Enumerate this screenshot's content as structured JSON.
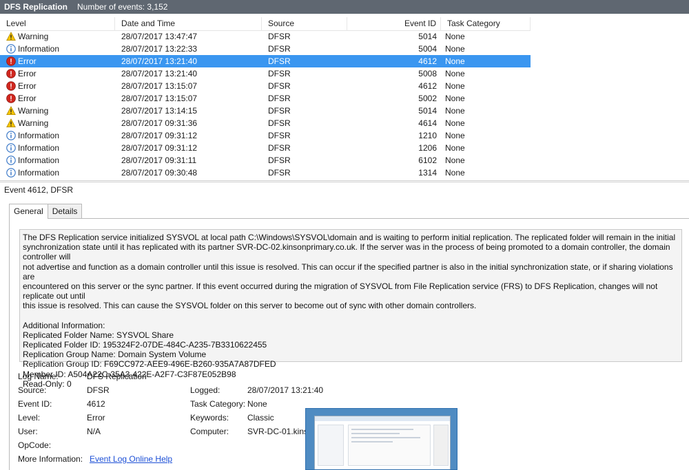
{
  "titlebar": {
    "app_name": "DFS Replication",
    "event_count": "Number of events: 3,152"
  },
  "columns": {
    "level": "Level",
    "date": "Date and Time",
    "source": "Source",
    "event_id": "Event ID",
    "task_category": "Task Category"
  },
  "events": [
    {
      "level": "Warning",
      "icon": "warning-icon",
      "date": "28/07/2017 13:47:47",
      "source": "DFSR",
      "event_id": "5014",
      "category": "None"
    },
    {
      "level": "Information",
      "icon": "information-icon",
      "date": "28/07/2017 13:22:33",
      "source": "DFSR",
      "event_id": "5004",
      "category": "None"
    },
    {
      "level": "Error",
      "icon": "error-icon",
      "date": "28/07/2017 13:21:40",
      "source": "DFSR",
      "event_id": "4612",
      "category": "None",
      "selected": true
    },
    {
      "level": "Error",
      "icon": "error-icon",
      "date": "28/07/2017 13:21:40",
      "source": "DFSR",
      "event_id": "5008",
      "category": "None"
    },
    {
      "level": "Error",
      "icon": "error-icon",
      "date": "28/07/2017 13:15:07",
      "source": "DFSR",
      "event_id": "4612",
      "category": "None"
    },
    {
      "level": "Error",
      "icon": "error-icon",
      "date": "28/07/2017 13:15:07",
      "source": "DFSR",
      "event_id": "5002",
      "category": "None"
    },
    {
      "level": "Warning",
      "icon": "warning-icon",
      "date": "28/07/2017 13:14:15",
      "source": "DFSR",
      "event_id": "5014",
      "category": "None"
    },
    {
      "level": "Warning",
      "icon": "warning-icon",
      "date": "28/07/2017 09:31:36",
      "source": "DFSR",
      "event_id": "4614",
      "category": "None"
    },
    {
      "level": "Information",
      "icon": "information-icon",
      "date": "28/07/2017 09:31:12",
      "source": "DFSR",
      "event_id": "1210",
      "category": "None"
    },
    {
      "level": "Information",
      "icon": "information-icon",
      "date": "28/07/2017 09:31:12",
      "source": "DFSR",
      "event_id": "1206",
      "category": "None"
    },
    {
      "level": "Information",
      "icon": "information-icon",
      "date": "28/07/2017 09:31:11",
      "source": "DFSR",
      "event_id": "6102",
      "category": "None"
    },
    {
      "level": "Information",
      "icon": "information-icon",
      "date": "28/07/2017 09:30:48",
      "source": "DFSR",
      "event_id": "1314",
      "category": "None"
    }
  ],
  "detail": {
    "header": "Event 4612, DFSR",
    "tabs": [
      "General",
      "Details"
    ],
    "description_lines": [
      "The DFS Replication service initialized SYSVOL at local path C:\\Windows\\SYSVOL\\domain and is waiting to perform initial replication. The replicated folder will remain in the initial",
      "synchronization state until it has replicated with its partner SVR-DC-02.kinsonprimary.co.uk. If the server was in the process of being promoted to a domain controller, the domain controller will",
      "not advertise and function as a domain controller until this issue is resolved. This can occur if the specified partner is also in the initial synchronization state, or if sharing violations are",
      "encountered on this server or the sync partner. If this event occurred during the migration of SYSVOL from File Replication service (FRS) to DFS Replication, changes will not replicate out until",
      "this issue is resolved. This can cause the SYSVOL folder on this server to become out of sync with other domain controllers."
    ],
    "additional_lines": [
      "Additional Information:",
      "Replicated Folder Name: SYSVOL Share",
      "Replicated Folder ID: 195324F2-07DE-484C-A235-7B3310622455",
      "Replication Group Name: Domain System Volume",
      "Replication Group ID: F69CC972-AEE9-496E-B260-935A7A87DFED",
      "Member ID: A504A22C-35A3-422E-A2F7-C3F87E052B98",
      "Read-Only: 0"
    ],
    "fields": {
      "log_name_label": "Log Name:",
      "log_name": "DFS Replication",
      "source_label": "Source:",
      "source": "DFSR",
      "logged_label": "Logged:",
      "logged": "28/07/2017 13:21:40",
      "event_id_label": "Event ID:",
      "event_id": "4612",
      "task_category_label": "Task Category:",
      "task_category": "None",
      "level_label": "Level:",
      "level": "Error",
      "keywords_label": "Keywords:",
      "keywords": "Classic",
      "user_label": "User:",
      "user": "N/A",
      "computer_label": "Computer:",
      "computer": "SVR-DC-01.kinso",
      "opcode_label": "OpCode:",
      "more_info_label": "More Information:",
      "more_info_link": "Event Log Online Help"
    }
  },
  "colors": {
    "titlebar": "#5f6771",
    "selection": "#3a96f0",
    "warning": "#f5c400",
    "error": "#d0271f",
    "info": "#2d6fc4",
    "link": "#1c4fd6"
  }
}
